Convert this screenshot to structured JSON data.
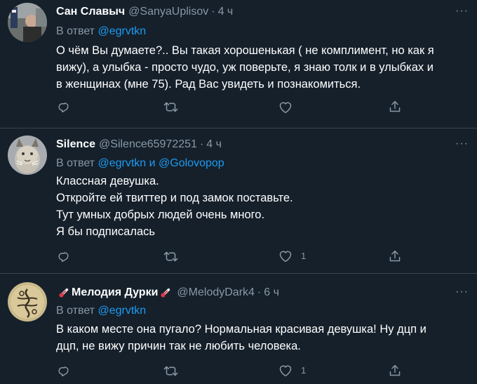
{
  "tweets": [
    {
      "name": "Сан Славыч",
      "name_prefix_emoji": "",
      "name_suffix_emoji": "",
      "handle": "@SanyaUplisov",
      "time": "4 ч",
      "reply_prefix": "В ответ",
      "mention1": "@egrvtkn",
      "mention_joiner": "",
      "mention2": "",
      "lines": [
        "О чём Вы думаете?.. Вы такая хорошенькая ( не комплимент, но как я",
        "вижу), а улыбка - просто чудо, уж поверьте, я знаю толк и в улыбках и",
        "в женщинах (мне 75). Рад Вас увидеть и познакомиться."
      ],
      "like_count": ""
    },
    {
      "name": "Silence",
      "name_prefix_emoji": "",
      "name_suffix_emoji": "",
      "handle": "@Silence65972251",
      "time": "4 ч",
      "reply_prefix": "В ответ",
      "mention1": "@egrvtkn",
      "mention_joiner": "и",
      "mention2": "@Golovopop",
      "lines": [
        "Классная девушка.",
        "Откройте ей твиттер и под замок поставьте.",
        "Тут умных добрых людей очень много.",
        "Я бы подписалась"
      ],
      "like_count": "1"
    },
    {
      "name": "Мелодия Дурки",
      "name_prefix_emoji": "thermometer",
      "name_suffix_emoji": "thermometer",
      "handle": "@MelodyDark4",
      "time": "6 ч",
      "reply_prefix": "В ответ",
      "mention1": "@egrvtkn",
      "mention_joiner": "",
      "mention2": "",
      "lines": [
        "В каком месте она пугало? Нормальная красивая девушка! Ну дцп и",
        "дцп, не вижу причин так не любить человека."
      ],
      "like_count": "1"
    }
  ],
  "more_label": "···",
  "dot_label": "·",
  "icons": {
    "reply": "reply-icon",
    "retweet": "retweet-icon",
    "like": "like-icon",
    "share": "share-icon"
  },
  "colors": {
    "background": "#15202b",
    "divider": "#38444d",
    "secondary_text": "#8899a6",
    "link": "#1d9bf0"
  }
}
